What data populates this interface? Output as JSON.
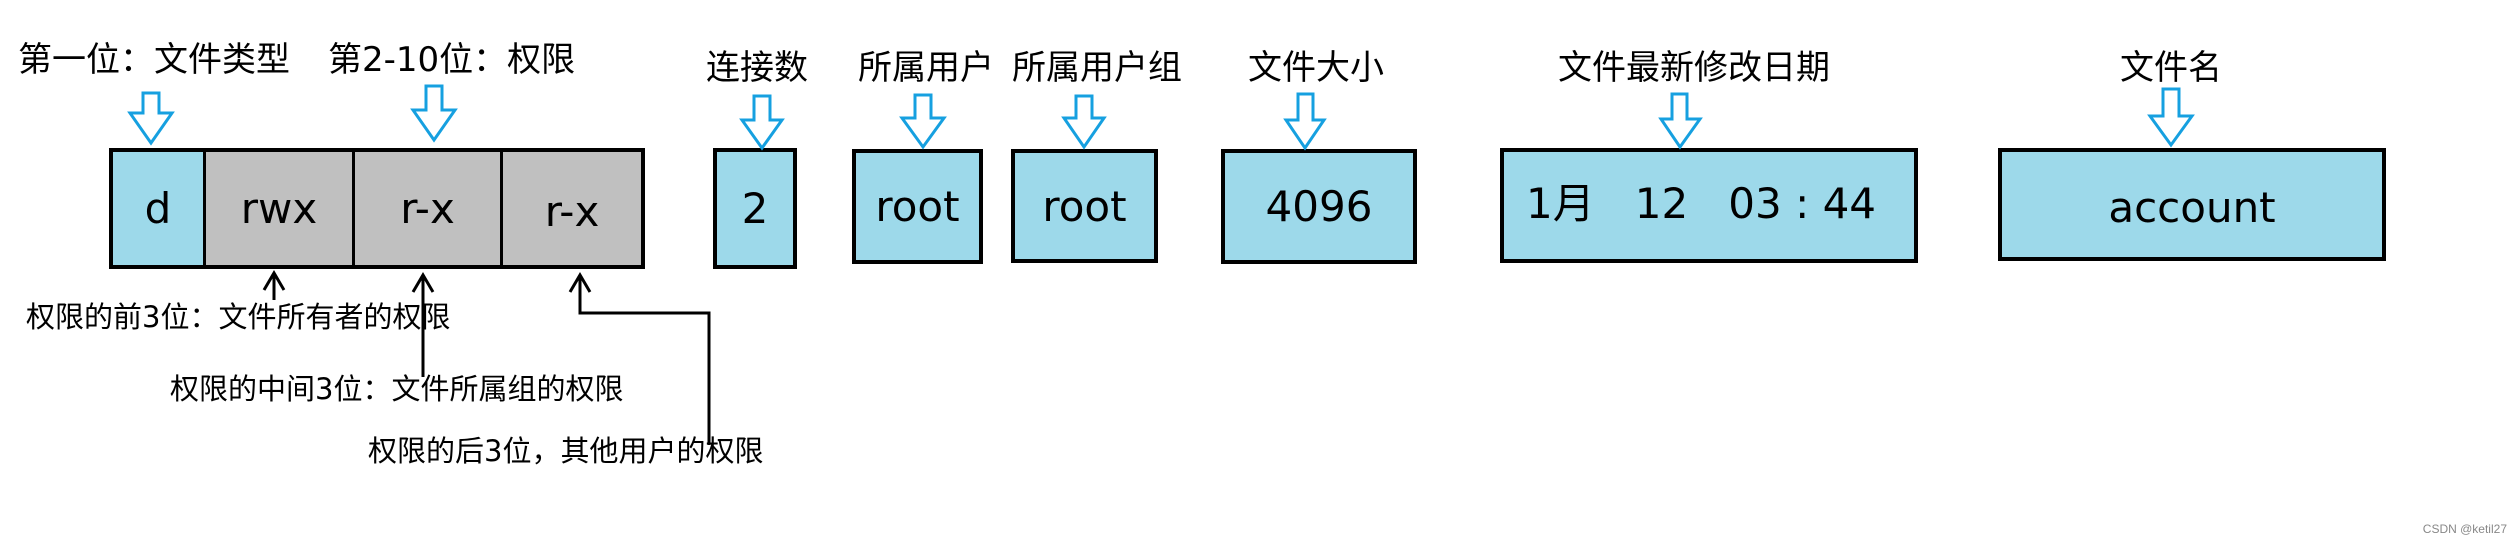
{
  "colors": {
    "field_fill": "#9DD9EA",
    "permission_fill": "#C0C0C0",
    "arrow_blue": "#16A0E0",
    "line_black": "#000000"
  },
  "headers": {
    "file_type": "第一位：文件类型",
    "permissions": "第2-10位：权限",
    "link_count": "连接数",
    "owner": "所属用户",
    "group": "所属用户组",
    "size": "文件大小",
    "mtime": "文件最新修改日期",
    "filename": "文件名"
  },
  "fields": {
    "file_type": "d",
    "perm_owner": "rwx",
    "perm_group": "r-x",
    "perm_other": "r-x",
    "link_count": "2",
    "owner": "root",
    "group": "root",
    "size": "4096",
    "mtime": "1月   12   03 : 44",
    "filename": "account"
  },
  "notes": {
    "owner_perm": "权限的前3位：文件所有者的权限",
    "group_perm": "权限的中间3位：文件所属组的权限",
    "other_perm": "权限的后3位，其他用户的权限"
  },
  "watermark": "CSDN @ketil27"
}
